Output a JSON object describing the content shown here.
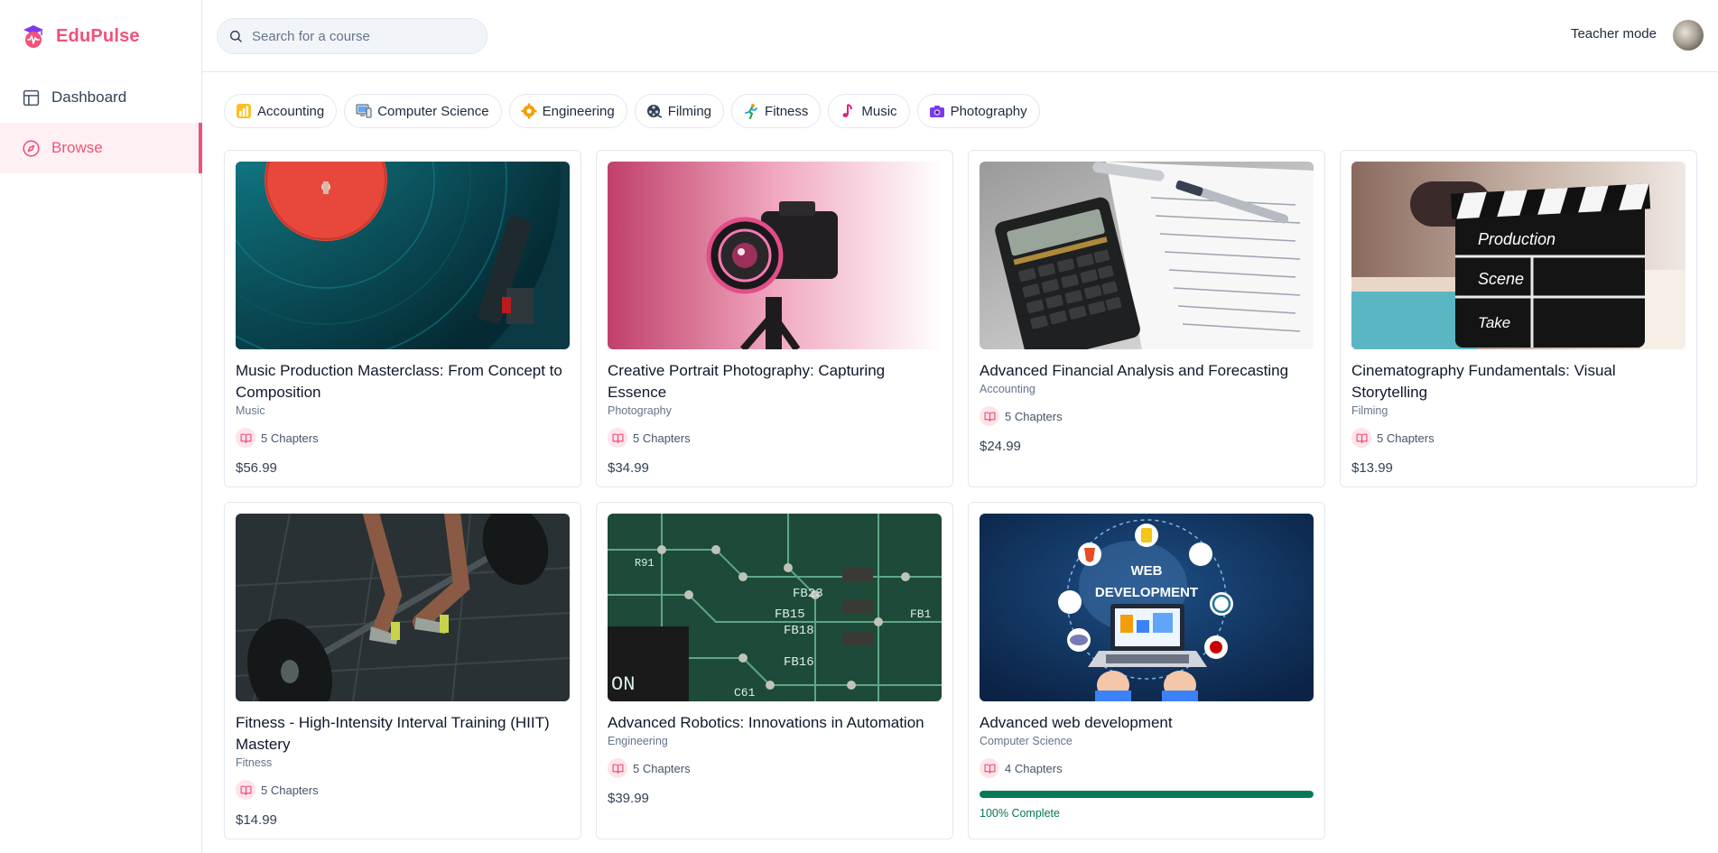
{
  "app": {
    "name": "EduPulse"
  },
  "sidebar": {
    "items": [
      {
        "label": "Dashboard",
        "icon": "layout-icon",
        "active": false
      },
      {
        "label": "Browse",
        "icon": "compass-icon",
        "active": true
      }
    ]
  },
  "header": {
    "search": {
      "placeholder": "Search for a course",
      "value": ""
    },
    "teacher_mode_label": "Teacher mode"
  },
  "categories": [
    {
      "label": "Accounting",
      "icon": "bar-chart-icon"
    },
    {
      "label": "Computer Science",
      "icon": "computer-icon"
    },
    {
      "label": "Engineering",
      "icon": "gear-icon"
    },
    {
      "label": "Filming",
      "icon": "film-reel-icon"
    },
    {
      "label": "Fitness",
      "icon": "runner-icon"
    },
    {
      "label": "Music",
      "icon": "music-note-icon"
    },
    {
      "label": "Photography",
      "icon": "camera-icon"
    }
  ],
  "courses": [
    {
      "title": "Music Production Masterclass: From Concept to Composition",
      "category": "Music",
      "chapters": "5 Chapters",
      "price": "$56.99"
    },
    {
      "title": "Creative Portrait Photography: Capturing Essence",
      "category": "Photography",
      "chapters": "5 Chapters",
      "price": "$34.99"
    },
    {
      "title": "Advanced Financial Analysis and Forecasting",
      "category": "Accounting",
      "chapters": "5 Chapters",
      "price": "$24.99"
    },
    {
      "title": "Cinematography Fundamentals: Visual Storytelling",
      "category": "Filming",
      "chapters": "5 Chapters",
      "price": "$13.99"
    },
    {
      "title": "Fitness - High-Intensity Interval Training (HIIT) Mastery",
      "category": "Fitness",
      "chapters": "5 Chapters",
      "price": "$14.99"
    },
    {
      "title": "Advanced Robotics: Innovations in Automation",
      "category": "Engineering",
      "chapters": "5 Chapters",
      "price": "$39.99"
    },
    {
      "title": "Advanced web development",
      "category": "Computer Science",
      "chapters": "4 Chapters",
      "progress": 100,
      "progress_label": "100% Complete"
    }
  ],
  "thumbnail_text": {
    "clapper": [
      "Production",
      "Scene",
      "Take"
    ],
    "pcb": [
      "FB23",
      "FB15",
      "FB18",
      "FB16",
      "ON",
      "C61",
      "R91",
      "FB1"
    ],
    "webdev": [
      "WEB",
      "DEVELOPMENT"
    ]
  },
  "colors": {
    "brand": "#f0527a",
    "progress": "#047857"
  }
}
